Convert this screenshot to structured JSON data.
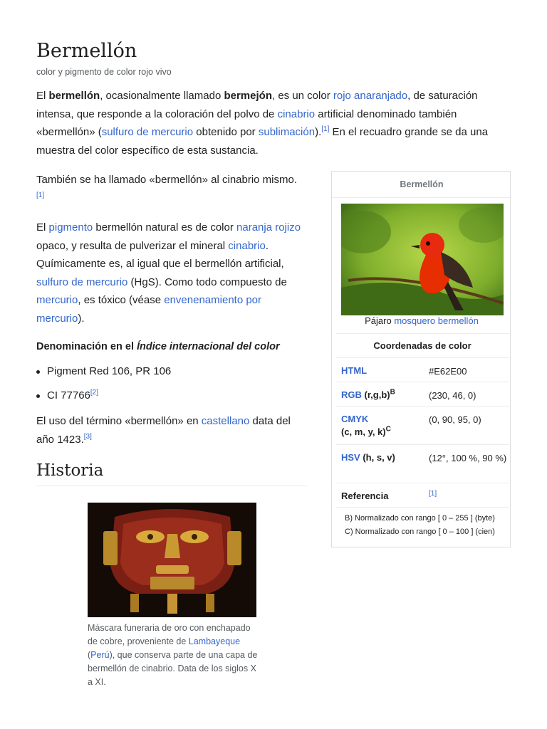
{
  "article": {
    "title": "Bermellón",
    "subtitle": "color y pigmento de color rojo vivo",
    "p1": {
      "t1": "El ",
      "b1": "bermellón",
      "t2": ", ocasionalmente llamado ",
      "b2": "bermejón",
      "t3": ", es un color ",
      "l1": "rojo anaranjado",
      "t4": ", de saturación intensa, que responde a la coloración del polvo de ",
      "l2": "cinabrio",
      "t5": " artificial denominado también «bermellón» (",
      "l3": "sulfuro de mercurio",
      "t6": " obtenido por ",
      "l4": "sublimación",
      "t7": ").",
      "ref": "[1]",
      "t8": "  En el recuadro grande se da una muestra del color específico de esta sustancia."
    },
    "p2": {
      "t1": "También se ha llamado «bermellón» al cinabrio mismo.",
      "ref": "[1]"
    },
    "p3": {
      "t1": "El ",
      "l1": "pigmento",
      "t2": " bermellón natural es de color ",
      "l2": "naranja rojizo",
      "t3": " opaco, y resulta de pulverizar el mineral ",
      "l3": "cinabrio",
      "t4": ". Químicamente es, al igual que el bermellón artificial, ",
      "l4": "sulfuro de mercurio",
      "t5": " (HgS). Como todo compuesto de ",
      "l5": "mercurio",
      "t6": ", es tóxico (véase ",
      "l6": "envenenamiento por mercurio",
      "t7": ")."
    },
    "denomination": {
      "prefix": "Denominación en el ",
      "link": "Índice internacional del color"
    },
    "bullets": [
      {
        "text": "Pigment Red 106, PR 106",
        "ref": ""
      },
      {
        "text": "CI 77766",
        "ref": "[2]"
      }
    ],
    "p4": {
      "t1": "El uso del término «bermellón» en ",
      "l1": "castellano",
      "t2": " data del año 1423.",
      "ref": "[3]"
    },
    "history_heading": "Historia",
    "mask_caption": {
      "t1": "Máscara funeraria de oro con enchapado de cobre, proveniente de ",
      "l1": "Lambayeque",
      "t2": " (",
      "l2": "Perú",
      "t3": "), que conserva parte de una capa de bermellón de cinabrio. Data de los siglos X a XI."
    }
  },
  "infobox": {
    "title": "Bermellón",
    "image_caption_prefix": "Pájaro ",
    "image_caption_link": "mosquero bermellón",
    "section_title": "Coordenadas de color",
    "rows": [
      {
        "label_link": "HTML",
        "label_rest": "",
        "sup": "",
        "value": "#E62E00"
      },
      {
        "label_link": "RGB",
        "label_rest": " (r,g,b)",
        "sup": "B",
        "value": "(230, 46, 0)"
      },
      {
        "label_link": "CMYK",
        "label_rest": "(c, m, y, k)",
        "sup": "C",
        "value": "(0, 90, 95, 0)"
      },
      {
        "label_link": "HSV",
        "label_rest": " (h, s, v)",
        "sup": "",
        "value": "(12°, 100 %, 90 %)"
      }
    ],
    "reference_label": "Referencia",
    "reference_value": "[1]",
    "notes": [
      "B) Normalizado con rango [ 0 – 255 ] (byte)",
      "C) Normalizado con rango [ 0 – 100 ] (cien)"
    ]
  },
  "colors": {
    "link": "#3366cc",
    "vermilion": "#E62E00"
  }
}
